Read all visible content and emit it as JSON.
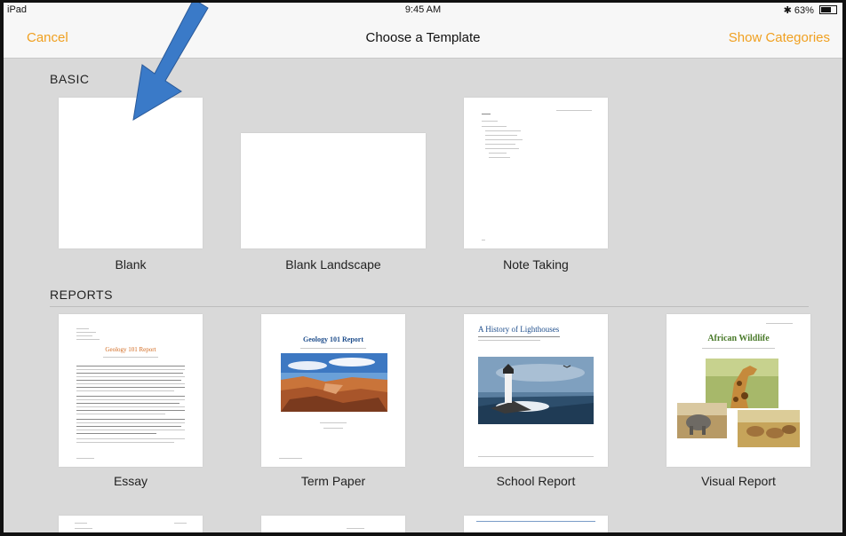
{
  "status_bar": {
    "carrier": "iPad",
    "time": "9:45 AM",
    "battery": "63%"
  },
  "nav": {
    "cancel": "Cancel",
    "title": "Choose a Template",
    "show_categories": "Show Categories"
  },
  "sections": {
    "basic": "BASIC",
    "reports": "REPORTS"
  },
  "templates": {
    "blank": "Blank",
    "blank_landscape": "Blank Landscape",
    "note_taking": "Note Taking",
    "essay": "Essay",
    "term_paper": "Term Paper",
    "school_report": "School Report",
    "visual_report": "Visual Report"
  },
  "thumb_text": {
    "essay_title": "Geology 101 Report",
    "term_title": "Geology 101 Report",
    "school_title": "A History of Lighthouses",
    "visual_title": "African Wildlife"
  },
  "colors": {
    "accent": "#f0a020",
    "background": "#d9d9d9",
    "bar": "#f7f7f7",
    "arrow": "#3a7ac8"
  }
}
